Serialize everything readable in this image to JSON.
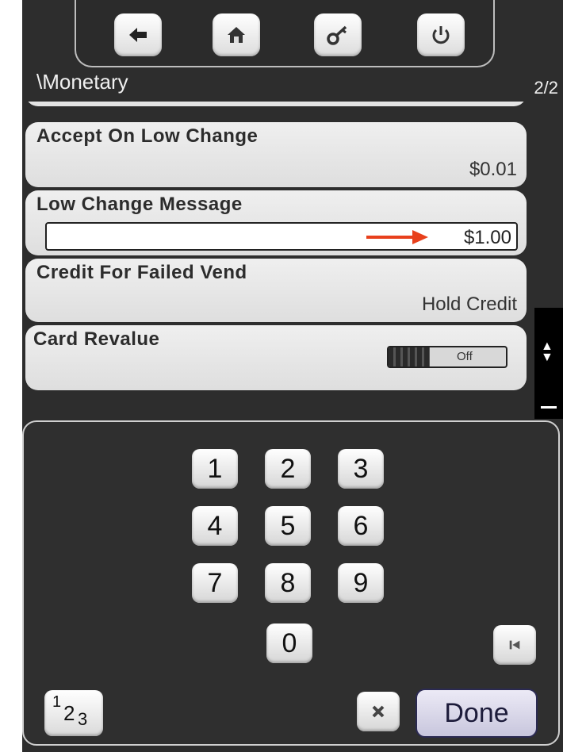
{
  "nav": {
    "buttons": [
      {
        "name": "back-arrow-icon"
      },
      {
        "name": "home-icon"
      },
      {
        "name": "key-icon"
      },
      {
        "name": "power-icon"
      }
    ]
  },
  "header": {
    "title": "\\Monetary",
    "page": "2/2"
  },
  "settings": {
    "accept_low_change": {
      "label": "Accept On Low Change",
      "value": "$0.01"
    },
    "low_change_message": {
      "label": "Low Change Message",
      "value": "$1.00"
    },
    "credit_failed_vend": {
      "label": "Credit For Failed Vend",
      "value": "Hold Credit"
    },
    "card_revalue": {
      "label": "Card Revalue",
      "toggle_state": "Off"
    }
  },
  "keypad": {
    "keys": [
      "1",
      "2",
      "3",
      "4",
      "5",
      "6",
      "7",
      "8",
      "9",
      "0"
    ],
    "mode_label": {
      "a": "1",
      "b": "2",
      "c": "3"
    },
    "done_label": "Done"
  },
  "colors": {
    "background": "#2d2d2d",
    "panel": "#e6e6e6",
    "arrow": "#e8401c",
    "done_border": "#2b2a52"
  }
}
